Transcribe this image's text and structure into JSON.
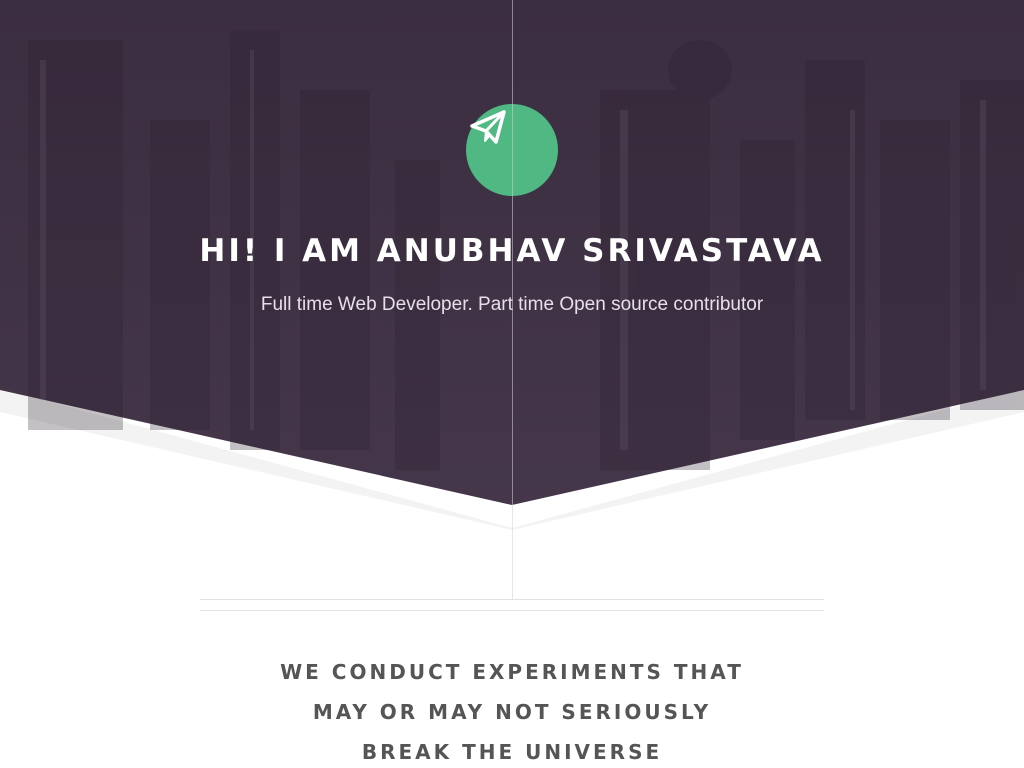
{
  "hero": {
    "icon": "paper-plane-icon",
    "title": "HI! I AM ANUBHAV SRIVASTAVA",
    "subtitle": "Full time Web Developer. Part time Open source contributor"
  },
  "tagline": {
    "lines": [
      "WE CONDUCT EXPERIMENTS THAT",
      "MAY OR MAY NOT SERIOUSLY",
      "BREAK THE UNIVERSE"
    ]
  },
  "colors": {
    "hero_overlay": "#3d2f42",
    "accent_green": "#4fb883",
    "tagline_text": "#555555",
    "page_background": "#ffffff"
  }
}
